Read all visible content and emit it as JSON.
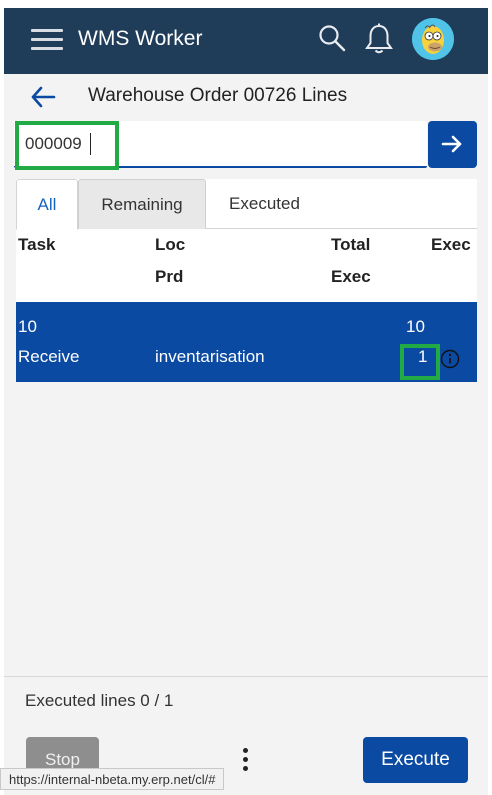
{
  "header": {
    "app_title": "WMS Worker",
    "icons": [
      "menu-icon",
      "search-icon",
      "bell-icon",
      "avatar"
    ]
  },
  "page": {
    "title": "Warehouse Order 00726 Lines"
  },
  "scan": {
    "value": "000009",
    "placeholder": ""
  },
  "tabs": [
    {
      "label": "All",
      "active": true
    },
    {
      "label": "Remaining",
      "active": false
    },
    {
      "label": "Executed",
      "active": false
    }
  ],
  "table": {
    "headers": {
      "task": "Task",
      "loc": "Loc",
      "prd": "Prd",
      "total": "Total",
      "exec_sub": "Exec",
      "exec": "Exec"
    },
    "rows": [
      {
        "task": "10",
        "type": "Receive",
        "loc": "inventarisation",
        "total": "10",
        "exec": "1"
      }
    ]
  },
  "footer": {
    "executed_lines": "Executed lines 0 / 1",
    "stop_label": "Stop",
    "execute_label": "Execute"
  },
  "status_bar": {
    "url": "https://internal-nbeta.my.erp.net/cl/#"
  },
  "colors": {
    "appbar": "#1f3c59",
    "primary": "#0b4aa2",
    "highlight": "#22aa44",
    "stop": "#8e8e8e"
  }
}
